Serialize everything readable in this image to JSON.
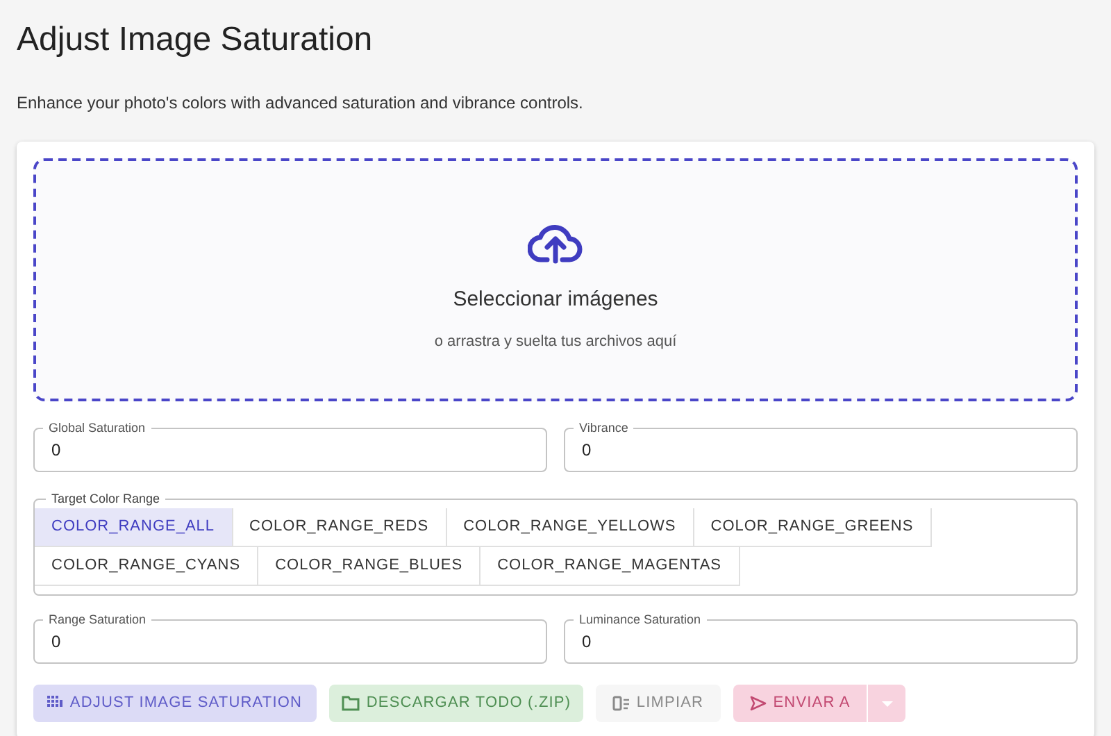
{
  "title": "Adjust Image Saturation",
  "subtitle": "Enhance your photo's colors with advanced saturation and vibrance controls.",
  "dropzone": {
    "heading": "Seleccionar imágenes",
    "hint": "o arrastra y suelta tus archivos aquí"
  },
  "fields_top": [
    {
      "label": "Global Saturation",
      "value": "0"
    },
    {
      "label": "Vibrance",
      "value": "0"
    }
  ],
  "color_range": {
    "label": "Target Color Range",
    "options": [
      {
        "label": "COLOR_RANGE_ALL",
        "selected": true
      },
      {
        "label": "COLOR_RANGE_REDS",
        "selected": false
      },
      {
        "label": "COLOR_RANGE_YELLOWS",
        "selected": false
      },
      {
        "label": "COLOR_RANGE_GREENS",
        "selected": false
      },
      {
        "label": "COLOR_RANGE_CYANS",
        "selected": false
      },
      {
        "label": "COLOR_RANGE_BLUES",
        "selected": false
      },
      {
        "label": "COLOR_RANGE_MAGENTAS",
        "selected": false
      }
    ]
  },
  "fields_bottom": [
    {
      "label": "Range Saturation",
      "value": "0"
    },
    {
      "label": "Luminance Saturation",
      "value": "0"
    }
  ],
  "buttons": [
    {
      "kind": "adjust",
      "label": "ADJUST IMAGE SATURATION",
      "disabled": true
    },
    {
      "kind": "download",
      "label": "DESCARGAR TODO (.ZIP)",
      "disabled": true
    },
    {
      "kind": "clear",
      "label": "LIMPIAR",
      "disabled": true
    },
    {
      "kind": "send",
      "label": "ENVIAR A",
      "disabled": true
    }
  ]
}
